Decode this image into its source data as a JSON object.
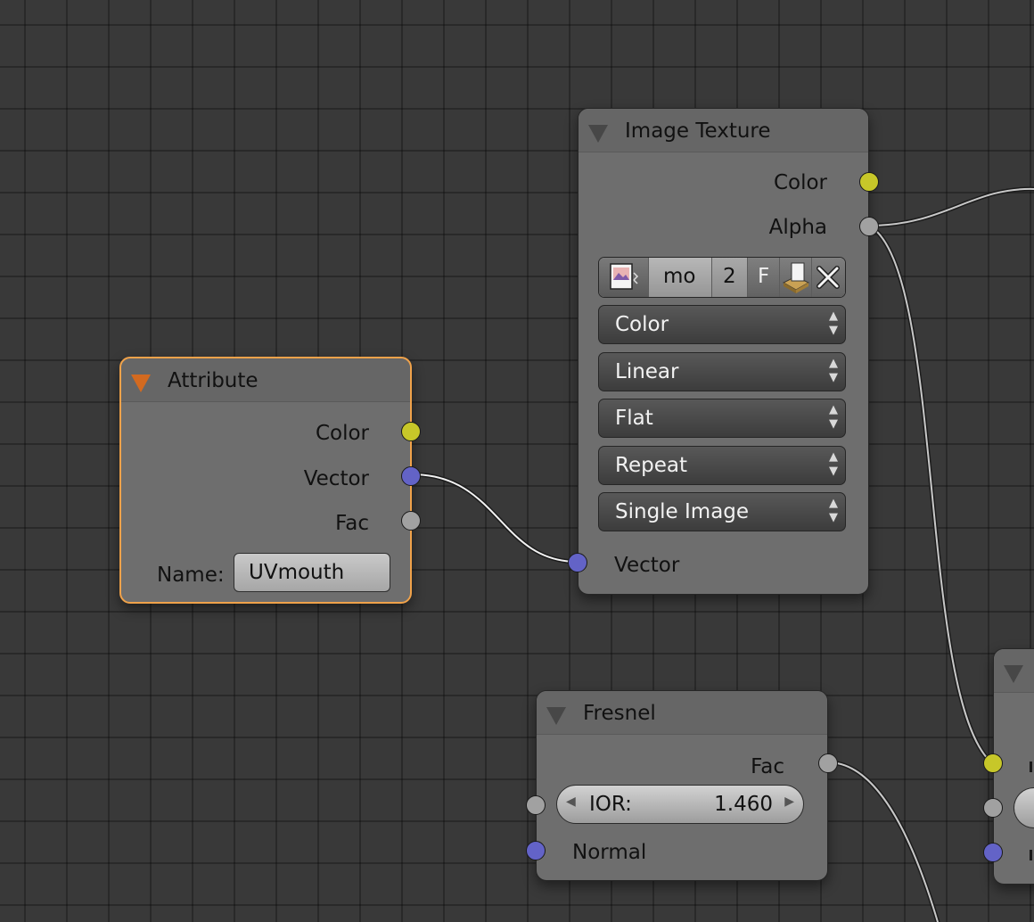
{
  "colors": {
    "socket_color": "#c7c729",
    "socket_value": "#a1a1a1",
    "socket_vector": "#6363c7",
    "active_outline": "#f0a24a"
  },
  "image_texture": {
    "title": "Image Texture",
    "out_color": "Color",
    "out_alpha": "Alpha",
    "image": {
      "name": "mo",
      "users": "2",
      "fake_user": "F"
    },
    "color_space": "Color",
    "interpolation": "Linear",
    "projection": "Flat",
    "extension": "Repeat",
    "source": "Single Image",
    "in_vector": "Vector"
  },
  "attribute": {
    "title": "Attribute",
    "out_color": "Color",
    "out_vector": "Vector",
    "out_fac": "Fac",
    "name_label": "Name:",
    "name_value": "UVmouth"
  },
  "fresnel": {
    "title": "Fresnel",
    "out_fac": "Fac",
    "ior_label": "IOR:",
    "ior_value": "1.460",
    "in_normal": "Normal"
  }
}
